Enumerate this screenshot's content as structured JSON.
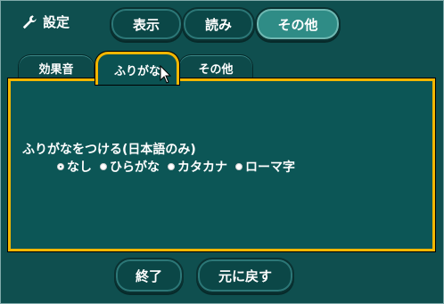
{
  "header": {
    "title": "設定",
    "buttons": [
      {
        "label": "表示",
        "active": false
      },
      {
        "label": "読み",
        "active": false
      },
      {
        "label": "その他",
        "active": true
      }
    ]
  },
  "tabs": [
    {
      "label": "効果音",
      "active": false
    },
    {
      "label": "ふりがな",
      "active": true
    },
    {
      "label": "その他",
      "active": false
    }
  ],
  "panel": {
    "setting_label": "ふりがなをつける(日本語のみ)",
    "options": [
      {
        "label": "なし",
        "selected": true
      },
      {
        "label": "ひらがな",
        "selected": false
      },
      {
        "label": "カタカナ",
        "selected": false
      },
      {
        "label": "ローマ字",
        "selected": false
      }
    ]
  },
  "footer": {
    "ok_label": "終了",
    "reset_label": "元に戻す"
  },
  "colors": {
    "background": "#0f4f4f",
    "accent": "#f2b600",
    "active_button": "#2f8c86"
  }
}
